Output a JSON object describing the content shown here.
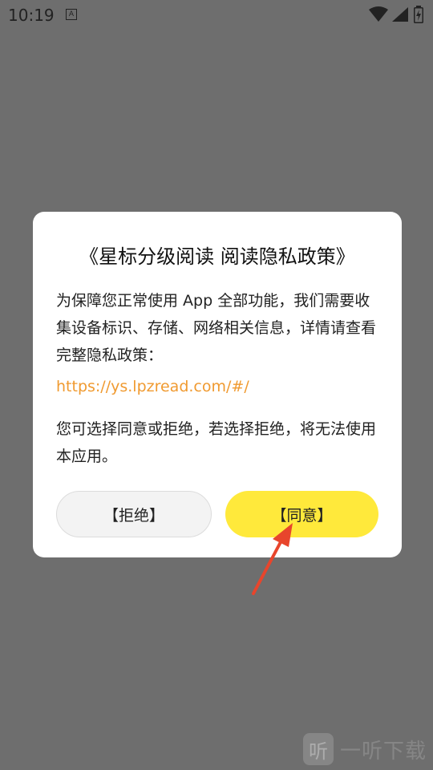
{
  "status_bar": {
    "time": "10:19",
    "a_icon": "A"
  },
  "dialog": {
    "title": "《星标分级阅读 阅读隐私政策》",
    "body": "为保障您正常使用 App 全部功能，我们需要收集设备标识、存储、网络相关信息，详情请查看完整隐私政策：",
    "link": "https://ys.lpzread.com/#/",
    "note": "您可选择同意或拒绝，若选择拒绝，将无法使用本应用。",
    "refuse_label": "【拒绝】",
    "agree_label": "【同意】"
  },
  "watermark": {
    "logo_glyph": "听",
    "text": "一听下载"
  },
  "colors": {
    "overlay": "#6e6e6e",
    "agree_button": "#ffe93b",
    "link": "#f09a30",
    "arrow": "#e8452c"
  },
  "icons": [
    "wifi-icon",
    "signal-icon",
    "battery-icon",
    "arrow-annotation"
  ]
}
